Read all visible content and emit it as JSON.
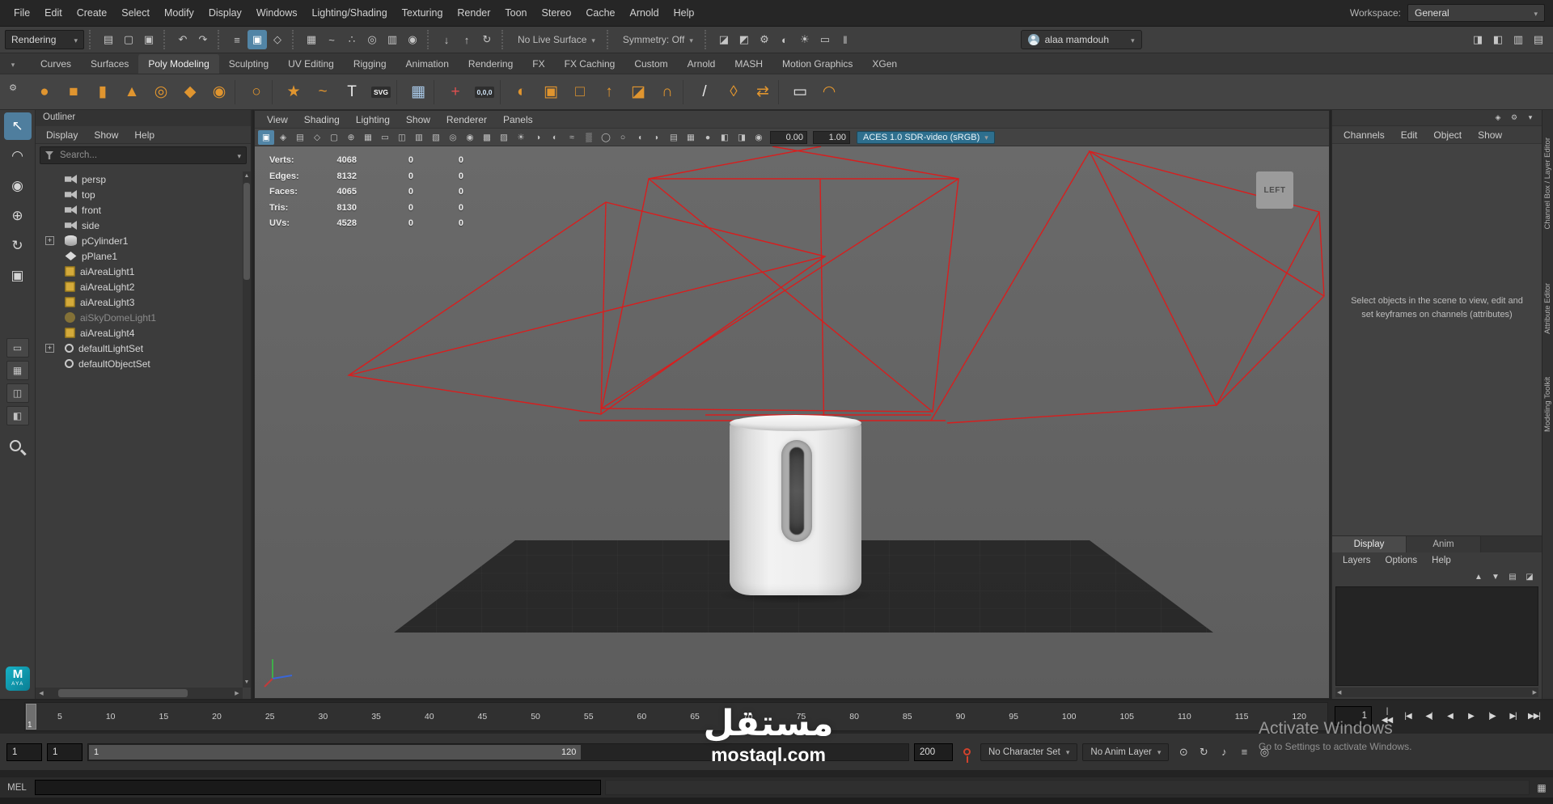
{
  "menubar": {
    "items": [
      "File",
      "Edit",
      "Create",
      "Select",
      "Modify",
      "Display",
      "Windows",
      "Lighting/Shading",
      "Texturing",
      "Render",
      "Toon",
      "Stereo",
      "Cache",
      "Arnold",
      "Help"
    ],
    "workspace_label": "Workspace:",
    "workspace_value": "General"
  },
  "statusline": {
    "menuset": "Rendering",
    "no_live_surface": "No Live Surface",
    "symmetry": "Symmetry: Off",
    "user": "alaa mamdouh",
    "file_icons": [
      {
        "name": "new-scene-icon",
        "glyph": "▤"
      },
      {
        "name": "open-scene-icon",
        "glyph": "▢"
      },
      {
        "name": "save-scene-icon",
        "glyph": "▣"
      }
    ],
    "edit_icons": [
      {
        "name": "undo-icon",
        "glyph": "↶"
      },
      {
        "name": "redo-icon",
        "glyph": "↷"
      }
    ],
    "mask_icons": [
      {
        "name": "select-hierarchy-icon",
        "glyph": "≡"
      },
      {
        "name": "select-object-icon",
        "glyph": "▣",
        "active": true
      },
      {
        "name": "select-component-icon",
        "glyph": "◇"
      }
    ],
    "snap_icons": [
      {
        "name": "snap-grid-icon",
        "glyph": "▦"
      },
      {
        "name": "snap-curve-icon",
        "glyph": "~"
      },
      {
        "name": "snap-point-icon",
        "glyph": "∴"
      },
      {
        "name": "snap-projected-center-icon",
        "glyph": "◎"
      },
      {
        "name": "snap-view-plane-icon",
        "glyph": "▥"
      },
      {
        "name": "make-live-icon",
        "glyph": "◉"
      }
    ],
    "history_icons": [
      {
        "name": "inputs-icon",
        "glyph": "↓"
      },
      {
        "name": "outputs-icon",
        "glyph": "↑"
      },
      {
        "name": "construction-history-icon",
        "glyph": "↻"
      }
    ],
    "render_icons": [
      {
        "name": "render-frame-icon",
        "glyph": "◪"
      },
      {
        "name": "ipr-render-icon",
        "glyph": "◩"
      },
      {
        "name": "render-settings-icon",
        "glyph": "⚙"
      },
      {
        "name": "hypershade-icon",
        "glyph": "◐"
      },
      {
        "name": "light-editor-icon",
        "glyph": "☀"
      },
      {
        "name": "render-sequence-icon",
        "glyph": "▭"
      },
      {
        "name": "pause-icon",
        "glyph": "‖"
      }
    ],
    "sidebar_icons": [
      {
        "name": "toggle-modeling-toolkit-icon",
        "glyph": "◨"
      },
      {
        "name": "toggle-attribute-editor-icon",
        "glyph": "◧"
      },
      {
        "name": "toggle-tool-settings-icon",
        "glyph": "▥"
      },
      {
        "name": "toggle-channel-box-icon",
        "glyph": "▤"
      }
    ]
  },
  "shelf": {
    "tabs": [
      {
        "label": "Curves"
      },
      {
        "label": "Surfaces"
      },
      {
        "label": "Poly Modeling",
        "active": true
      },
      {
        "label": "Sculpting"
      },
      {
        "label": "UV Editing"
      },
      {
        "label": "Rigging"
      },
      {
        "label": "Animation"
      },
      {
        "label": "Rendering"
      },
      {
        "label": "FX"
      },
      {
        "label": "FX Caching"
      },
      {
        "label": "Custom"
      },
      {
        "label": "Arnold"
      },
      {
        "label": "MASH"
      },
      {
        "label": "Motion Graphics"
      },
      {
        "label": "XGen"
      }
    ],
    "items": [
      {
        "name": "poly-sphere-icon",
        "glyph": "●",
        "color": "#e0952f"
      },
      {
        "name": "poly-cube-icon",
        "glyph": "■",
        "color": "#e0952f"
      },
      {
        "name": "poly-cylinder-icon",
        "glyph": "▮",
        "color": "#e0952f"
      },
      {
        "name": "poly-cone-icon",
        "glyph": "▲",
        "color": "#e0952f"
      },
      {
        "name": "poly-torus-icon",
        "glyph": "◎",
        "color": "#e0952f"
      },
      {
        "name": "poly-plane-icon",
        "glyph": "◆",
        "color": "#e0952f"
      },
      {
        "name": "poly-disc-icon",
        "glyph": "◉",
        "color": "#e0952f"
      },
      {
        "name": "shelf-separator",
        "sep": true
      },
      {
        "name": "nurbs-sphere-icon",
        "glyph": "○",
        "color": "#e0952f"
      },
      {
        "name": "shelf-separator",
        "sep": true
      },
      {
        "name": "curve-star-icon",
        "glyph": "★",
        "color": "#e0952f"
      },
      {
        "name": "ep-curve-icon",
        "glyph": "~",
        "color": "#e0952f"
      },
      {
        "name": "text-tool-icon",
        "glyph": "T",
        "color": "#e8e8e8"
      },
      {
        "name": "svg-tool-icon",
        "glyph": "SVG",
        "color": "#ffffff",
        "badge": true
      },
      {
        "name": "shelf-separator",
        "sep": true
      },
      {
        "name": "calculator-icon",
        "glyph": "▦",
        "color": "#a9c9e8"
      },
      {
        "name": "shelf-separator",
        "sep": true
      },
      {
        "name": "locator-icon",
        "glyph": "+",
        "color": "#e05050"
      },
      {
        "name": "origin-axis-icon",
        "glyph": "0,0,0",
        "color": "#cfe3f5",
        "badge": true
      },
      {
        "name": "shelf-separator",
        "sep": true
      },
      {
        "name": "boolean-icon",
        "glyph": "◐",
        "color": "#e0952f"
      },
      {
        "name": "combine-icon",
        "glyph": "▣",
        "color": "#e0952f"
      },
      {
        "name": "separate-icon",
        "glyph": "□",
        "color": "#e0952f"
      },
      {
        "name": "extrude-icon",
        "glyph": "↑",
        "color": "#e0952f"
      },
      {
        "name": "bevel-icon",
        "glyph": "◪",
        "color": "#e0952f"
      },
      {
        "name": "bridge-icon",
        "glyph": "∩",
        "color": "#e0952f"
      },
      {
        "name": "shelf-separator",
        "sep": true
      },
      {
        "name": "multi-cut-icon",
        "glyph": "/",
        "color": "#e8e8e8"
      },
      {
        "name": "target-weld-icon",
        "glyph": "◊",
        "color": "#e0952f"
      },
      {
        "name": "mirror-icon",
        "glyph": "⇄",
        "color": "#e0952f"
      },
      {
        "name": "shelf-separator",
        "sep": true
      },
      {
        "name": "quad-draw-icon",
        "glyph": "▭",
        "color": "#e8e8e8"
      },
      {
        "name": "sculpt-icon",
        "glyph": "◠",
        "color": "#e0952f"
      }
    ]
  },
  "toolbox": {
    "tools": [
      {
        "name": "select-tool",
        "glyph": "↖",
        "active": true
      },
      {
        "name": "lasso-tool",
        "glyph": "◠"
      },
      {
        "name": "paint-select-tool",
        "glyph": "◉"
      },
      {
        "name": "move-tool",
        "glyph": "⊕"
      },
      {
        "name": "rotate-tool",
        "glyph": "↻"
      },
      {
        "name": "scale-tool",
        "glyph": "▣"
      }
    ],
    "layouts": [
      {
        "name": "single-pane-layout-button",
        "glyph": "▭"
      },
      {
        "name": "four-pane-layout-button",
        "glyph": "▦"
      },
      {
        "name": "persp-outliner-layout-button",
        "glyph": "◫"
      },
      {
        "name": "split-pane-layout-button",
        "glyph": "◧"
      }
    ],
    "logo_m": "M",
    "logo_sub": "AYA"
  },
  "outliner": {
    "title": "Outliner",
    "menus": [
      "Display",
      "Show",
      "Help"
    ],
    "search_placeholder": "Search...",
    "items": [
      {
        "label": "persp",
        "icon": "camera"
      },
      {
        "label": "top",
        "icon": "camera"
      },
      {
        "label": "front",
        "icon": "camera"
      },
      {
        "label": "side",
        "icon": "camera"
      },
      {
        "label": "pCylinder1",
        "icon": "mesh",
        "expand": true
      },
      {
        "label": "pPlane1",
        "icon": "plane"
      },
      {
        "label": "aiAreaLight1",
        "icon": "arealight"
      },
      {
        "label": "aiAreaLight2",
        "icon": "arealight"
      },
      {
        "label": "aiAreaLight3",
        "icon": "arealight"
      },
      {
        "label": "aiSkyDomeLight1",
        "icon": "skydome",
        "dim": true
      },
      {
        "label": "aiAreaLight4",
        "icon": "arealight"
      },
      {
        "label": "defaultLightSet",
        "icon": "set",
        "expand": true
      },
      {
        "label": "defaultObjectSet",
        "icon": "set"
      }
    ]
  },
  "viewport": {
    "menus": [
      "View",
      "Shading",
      "Lighting",
      "Show",
      "Renderer",
      "Panels"
    ],
    "toolbar": {
      "exposure": "0.00",
      "gamma": "1.00",
      "view_transform": "ACES 1.0 SDR-video (sRGB)",
      "icons": [
        {
          "name": "select-camera-icon",
          "glyph": "▣",
          "active": true
        },
        {
          "name": "lock-camera-icon",
          "glyph": "◈"
        },
        {
          "name": "camera-attributes-icon",
          "glyph": "▤"
        },
        {
          "name": "bookmarks-icon",
          "glyph": "◇"
        },
        {
          "name": "image-plane-icon",
          "glyph": "▢"
        },
        {
          "name": "2d-pan-zoom-icon",
          "glyph": "⊕"
        },
        {
          "name": "grid-toggle-icon",
          "glyph": "▦"
        },
        {
          "name": "film-gate-icon",
          "glyph": "▭"
        },
        {
          "name": "resolution-gate-icon",
          "glyph": "◫"
        },
        {
          "name": "gate-mask-icon",
          "glyph": "▥"
        },
        {
          "name": "field-chart-icon",
          "glyph": "▧"
        },
        {
          "name": "safe-action-icon",
          "glyph": "◎"
        },
        {
          "name": "safe-title-icon",
          "glyph": "◉"
        },
        {
          "name": "frame-all-icon",
          "glyph": "▩"
        },
        {
          "name": "frame-selected-icon",
          "glyph": "▨"
        },
        {
          "name": "lighting-all-icon",
          "glyph": "☀"
        },
        {
          "name": "shadows-icon",
          "glyph": "◑"
        },
        {
          "name": "screen-space-ao-icon",
          "glyph": "◐"
        },
        {
          "name": "motion-blur-icon",
          "glyph": "≈"
        },
        {
          "name": "anti-aliasing-icon",
          "glyph": "▒"
        },
        {
          "name": "depth-of-field-icon",
          "glyph": "◯"
        },
        {
          "name": "isolate-select-icon",
          "glyph": "○"
        },
        {
          "name": "xray-icon",
          "glyph": "◖"
        },
        {
          "name": "xray-joints-icon",
          "glyph": "◗"
        },
        {
          "name": "wireframe-on-shaded-icon",
          "glyph": "▤"
        },
        {
          "name": "textured-mode-icon",
          "glyph": "▦"
        },
        {
          "name": "default-material-icon",
          "glyph": "●"
        },
        {
          "name": "exposure-icon",
          "glyph": "◧"
        },
        {
          "name": "gamma-icon",
          "glyph": "◨"
        },
        {
          "name": "color-management-icon",
          "glyph": "◉"
        }
      ]
    },
    "hud": {
      "rows": [
        {
          "label": "Verts:",
          "c1": "4068",
          "c2": "0",
          "c3": "0"
        },
        {
          "label": "Edges:",
          "c1": "8132",
          "c2": "0",
          "c3": "0"
        },
        {
          "label": "Faces:",
          "c1": "4065",
          "c2": "0",
          "c3": "0"
        },
        {
          "label": "Tris:",
          "c1": "8130",
          "c2": "0",
          "c3": "0"
        },
        {
          "label": "UVs:",
          "c1": "4528",
          "c2": "0",
          "c3": "0"
        }
      ]
    },
    "view_label": "LEFT"
  },
  "channelbox": {
    "menus": [
      "Channels",
      "Edit",
      "Object",
      "Show"
    ],
    "empty_message": "Select objects in the scene to view, edit and set keyframes on channels (attributes)",
    "top_icons": [
      {
        "name": "speed-slow-icon",
        "glyph": "◈"
      },
      {
        "name": "speed-medium-icon",
        "glyph": "⚙"
      },
      {
        "name": "hide-panel-icon",
        "glyph": "▾"
      }
    ]
  },
  "right_strip": {
    "labels": [
      "Channel Box / Layer Editor",
      "Attribute Editor",
      "Modeling Toolkit"
    ]
  },
  "layer_editor": {
    "tabs": [
      {
        "label": "Display",
        "active": true
      },
      {
        "label": "Anim"
      }
    ],
    "menus": [
      "Layers",
      "Options",
      "Help"
    ],
    "icons": [
      {
        "name": "move-layer-up-icon",
        "glyph": "▲"
      },
      {
        "name": "move-layer-down-icon",
        "glyph": "▼"
      },
      {
        "name": "new-empty-layer-icon",
        "glyph": "▤"
      },
      {
        "name": "new-layer-from-selected-icon",
        "glyph": "◪"
      }
    ]
  },
  "timeline": {
    "ticks": [
      "5",
      "10",
      "15",
      "20",
      "25",
      "30",
      "35",
      "40",
      "45",
      "50",
      "55",
      "60",
      "65",
      "70",
      "75",
      "80",
      "85",
      "90",
      "95",
      "100",
      "105",
      "110",
      "115",
      "120"
    ],
    "current_frame": "1",
    "current_time_field": "1",
    "playback": [
      {
        "name": "go-to-start-button",
        "glyph": "|◀◀"
      },
      {
        "name": "step-back-key-button",
        "glyph": "|◀"
      },
      {
        "name": "step-back-frame-button",
        "glyph": "◀|"
      },
      {
        "name": "play-backwards-button",
        "glyph": "◀"
      },
      {
        "name": "play-forwards-button",
        "glyph": "▶"
      },
      {
        "name": "step-forward-frame-button",
        "glyph": "|▶"
      },
      {
        "name": "step-forward-key-button",
        "glyph": "▶|"
      },
      {
        "name": "go-to-end-button",
        "glyph": "▶▶|"
      }
    ]
  },
  "rangebar": {
    "anim_start": "1",
    "play_start": "1",
    "range_start_label": "1",
    "range_end_label": "120",
    "anim_end": "200",
    "character_set": "No Character Set",
    "anim_layer": "No Anim Layer",
    "trailing_icons": [
      {
        "name": "playback-speed-icon",
        "glyph": "⊙"
      },
      {
        "name": "loop-playback-icon",
        "glyph": "↻"
      },
      {
        "name": "sound-toggle-icon",
        "glyph": "♪"
      },
      {
        "name": "time-snap-icon",
        "glyph": "≡"
      },
      {
        "name": "mute-icon",
        "glyph": "◎"
      }
    ]
  },
  "commandline": {
    "mode_label": "MEL"
  },
  "watermark": {
    "logo_text": "مستقل",
    "site_text": "mostaql.com"
  },
  "activate": {
    "line1": "Activate Windows",
    "line2": "Go to Settings to activate Windows."
  }
}
